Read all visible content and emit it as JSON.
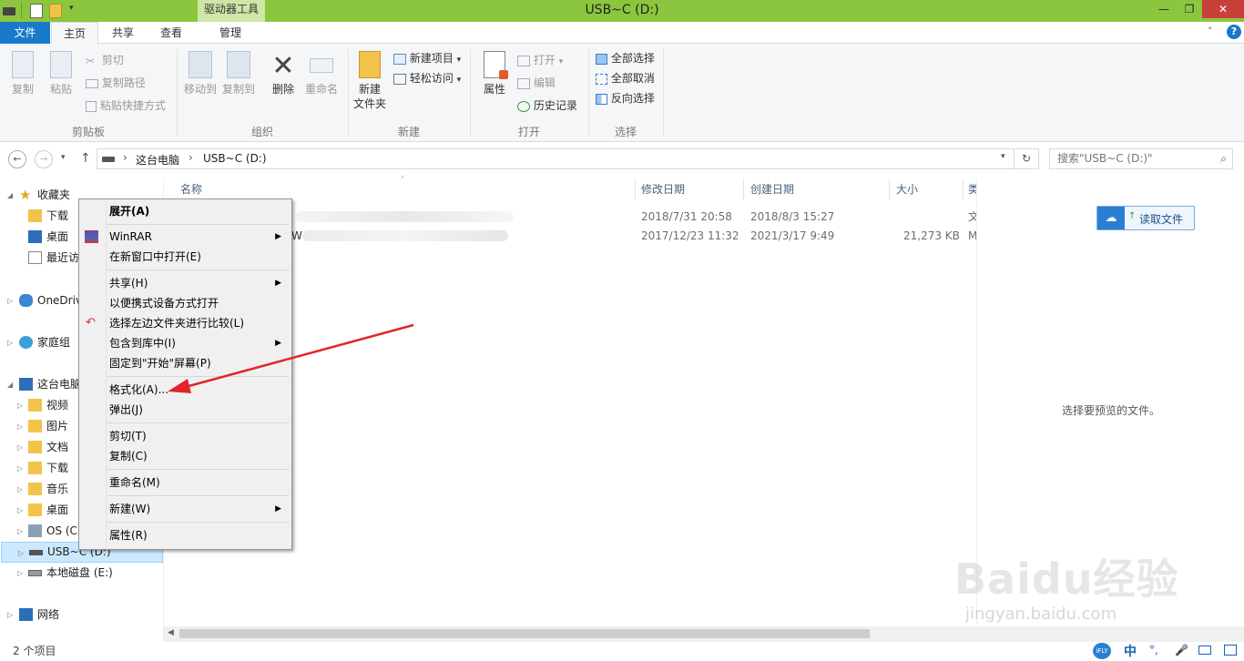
{
  "window": {
    "title": "USB~C (D:)",
    "context_tab": "驱动器工具"
  },
  "tabs": [
    {
      "label": "文件"
    },
    {
      "label": "主页"
    },
    {
      "label": "共享"
    },
    {
      "label": "查看"
    },
    {
      "label": "管理"
    }
  ],
  "ribbon": {
    "clipboard": {
      "copy": "复制",
      "paste": "粘贴",
      "cut": "剪切",
      "copy_path": "复制路径",
      "paste_shortcut": "粘贴快捷方式",
      "label": "剪贴板"
    },
    "organize": {
      "move_to": "移动到",
      "copy_to": "复制到",
      "delete": "删除",
      "rename": "重命名",
      "label": "组织"
    },
    "new": {
      "new_folder_line1": "新建",
      "new_folder_line2": "文件夹",
      "new_item": "新建项目",
      "easy_access": "轻松访问",
      "label": "新建"
    },
    "open": {
      "properties": "属性",
      "open": "打开",
      "edit": "编辑",
      "history": "历史记录",
      "label": "打开"
    },
    "select": {
      "select_all": "全部选择",
      "select_none": "全部取消",
      "invert": "反向选择",
      "label": "选择"
    }
  },
  "address": {
    "segments": [
      "这台电脑",
      "USB~C (D:)"
    ],
    "search_placeholder": "搜索\"USB~C (D:)\""
  },
  "nav": {
    "favorites": "收藏夹",
    "fav_items": [
      "下载",
      "桌面",
      "最近访"
    ],
    "onedrive": "OneDriv",
    "homegroup": "家庭组",
    "this_pc": "这台电脑",
    "pc_items": [
      "视频",
      "图片",
      "文档",
      "下载",
      "音乐",
      "桌面",
      "OS (C"
    ],
    "usb": "USB~C (D:)",
    "local_disk": "本地磁盘 (E:)",
    "network": "网络"
  },
  "columns": {
    "name": "名称",
    "modified": "修改日期",
    "created": "创建日期",
    "size": "大小",
    "type": "类"
  },
  "files": [
    {
      "name_suffix": "",
      "modified": "2018/7/31 20:58",
      "created": "2018/8/3 15:27",
      "size": "",
      "type": "文"
    },
    {
      "name_suffix": "W",
      "modified": "2017/12/23 11:32",
      "created": "2021/3/17 9:49",
      "size": "21,273 KB",
      "type": "M"
    }
  ],
  "context_menu": {
    "items": [
      "展开(A)",
      "WinRAR",
      "在新窗口中打开(E)",
      "共享(H)",
      "以便携式设备方式打开",
      "选择左边文件夹进行比较(L)",
      "包含到库中(I)",
      "固定到\"开始\"屏幕(P)",
      "格式化(A)...",
      "弹出(J)",
      "剪切(T)",
      "复制(C)",
      "重命名(M)",
      "新建(W)",
      "属性(R)"
    ]
  },
  "preview": {
    "read_button": "读取文件",
    "empty_text": "选择要预览的文件。"
  },
  "status": {
    "count": "2 个项目"
  },
  "watermark": {
    "logo": "Baidu经验",
    "url": "jingyan.baidu.com"
  },
  "tray": {
    "ime": "中"
  },
  "colors": {
    "titlebar": "#8cc63f",
    "file_tab": "#1979ca",
    "selection": "#cce8ff",
    "arrow": "#e0262b"
  }
}
